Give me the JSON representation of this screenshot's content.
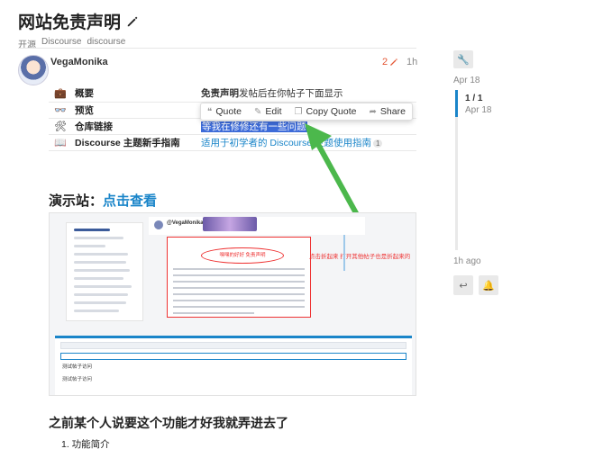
{
  "topic": {
    "title": "网站免责声明",
    "tags": [
      "开源",
      "Discourse",
      "discourse"
    ]
  },
  "post": {
    "username": "VegaMonika",
    "edit_count": "2",
    "time": "1h"
  },
  "info_table": [
    {
      "icon": "briefcase-icon",
      "glyph": "💼",
      "key": "概要",
      "value_bold": "免责声明",
      "value_rest": "发帖后在你帖子下面显示"
    },
    {
      "icon": "glasses-icon",
      "glyph": "👓",
      "key": "预览",
      "value_bold": "",
      "value_rest": ""
    },
    {
      "icon": "tools-icon",
      "glyph": "🛠",
      "key": "仓库链接",
      "value_selected": "等我在修修还有一些问题"
    },
    {
      "icon": "book-icon",
      "glyph": "📖",
      "key": "Discourse 主题新手指南",
      "value_link": "适用于初学者的 Discourse 主题使用指南",
      "badge": "1"
    }
  ],
  "quote_bar": {
    "quote": "Quote",
    "edit": "Edit",
    "copy_quote": "Copy Quote",
    "share": "Share"
  },
  "demo": {
    "label": "演示站：",
    "link": "点击查看"
  },
  "screenshot": {
    "username": "@VegaMonika",
    "oval_text": "嘿嘿的好好 免责声明",
    "note": "点击折起来 打开其他帖子也是折起来的",
    "composer_title": "测试帖子访问",
    "composer_text": "测试帖子访问"
  },
  "section": {
    "heading": "之前某个人说要这个功能才好我就弄进去了",
    "list_item_1": "1. 功能简介"
  },
  "timeline": {
    "date_top": "Apr 18",
    "count": "1 / 1",
    "current_date": "Apr 18",
    "ago": "1h ago"
  },
  "colors": {
    "accent": "#1a85c9",
    "edit": "#e45735",
    "arrow": "#4cb84c",
    "annotation": "#e33333"
  }
}
